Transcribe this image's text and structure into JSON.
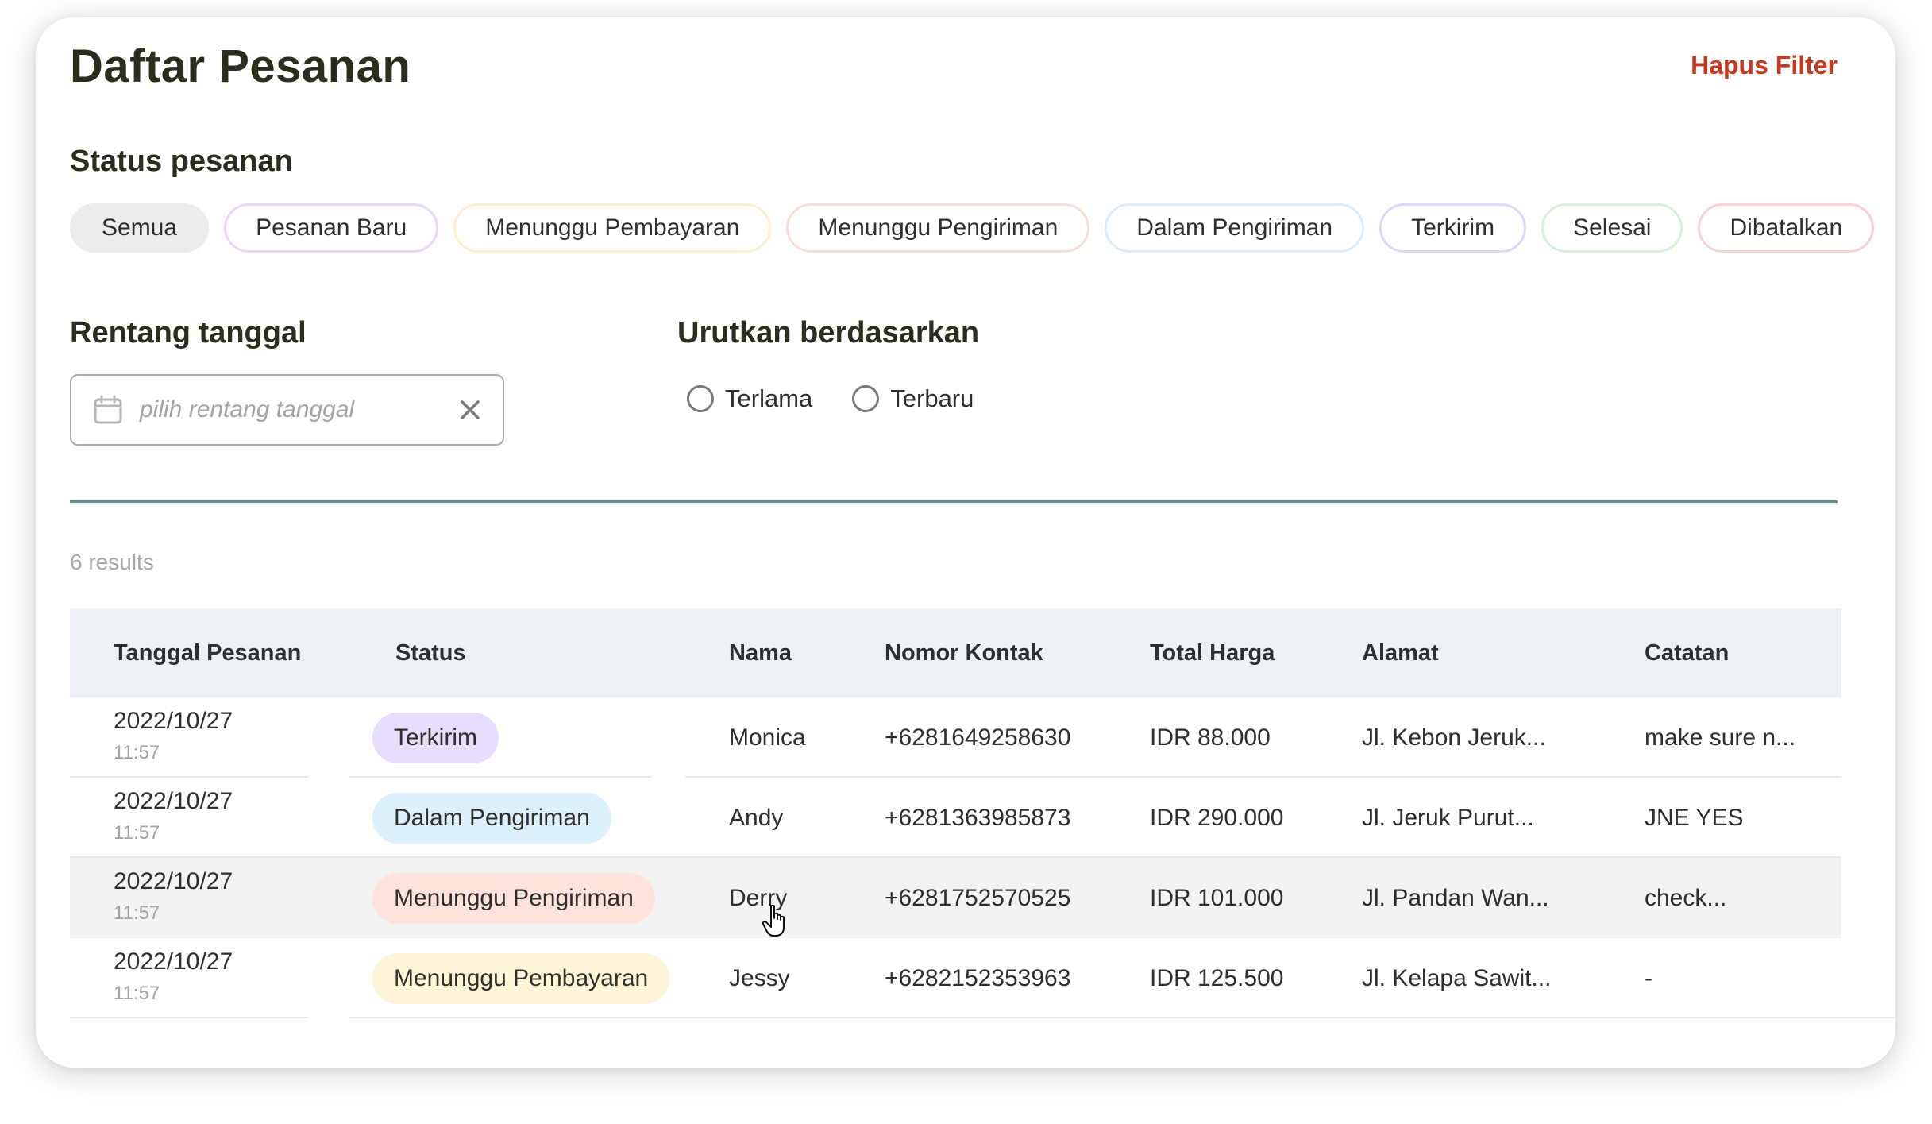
{
  "page": {
    "title": "Daftar Pesanan",
    "clear_filter": "Hapus Filter"
  },
  "status_filter": {
    "label": "Status pesanan",
    "chips": [
      "Semua",
      "Pesanan Baru",
      "Menunggu Pembayaran",
      "Menunggu Pengiriman",
      "Dalam Pengiriman",
      "Terkirim",
      "Selesai",
      "Dibatalkan"
    ],
    "selected": "Semua"
  },
  "date_range": {
    "label": "Rentang tanggal",
    "placeholder": "pilih rentang tanggal"
  },
  "sort": {
    "label": "Urutkan berdasarkan",
    "options": [
      "Terlama",
      "Terbaru"
    ]
  },
  "results_text": "6 results",
  "table": {
    "headers": [
      "Tanggal Pesanan",
      "Status",
      "Nama",
      "Nomor Kontak",
      "Total Harga",
      "Alamat",
      "Catatan"
    ],
    "rows": [
      {
        "date": "2022/10/27",
        "time": "11:57",
        "status": "Terkirim",
        "name": "Monica",
        "phone": "+6281649258630",
        "total": "IDR 88.000",
        "address": "Jl. Kebon Jeruk...",
        "note": "make sure n..."
      },
      {
        "date": "2022/10/27",
        "time": "11:57",
        "status": "Dalam Pengiriman",
        "name": "Andy",
        "phone": "+6281363985873",
        "total": "IDR 290.000",
        "address": "Jl. Jeruk Purut...",
        "note": "JNE YES"
      },
      {
        "date": "2022/10/27",
        "time": "11:57",
        "status": "Menunggu Pengiriman",
        "name": "Derry",
        "phone": "+6281752570525",
        "total": "IDR 101.000",
        "address": "Jl. Pandan Wan...",
        "note": "check..."
      },
      {
        "date": "2022/10/27",
        "time": "11:57",
        "status": "Menunggu Pembayaran",
        "name": "Jessy",
        "phone": "+6282152353963",
        "total": "IDR 125.500",
        "address": "Jl. Kelapa Sawit...",
        "note": "-"
      }
    ]
  },
  "colors": {
    "title": "#2b2d1f",
    "clear_filter": "#c43a1f",
    "divider": "#5e9193",
    "header_bg": "#edf0f5",
    "badge_terkirim": "#e6defa",
    "badge_dalam_pengiriman": "#dcf0fb",
    "badge_menunggu_pengiriman": "#fde3dc",
    "badge_menunggu_pembayaran": "#fdf5d8"
  },
  "icons": [
    "calendar-icon",
    "close-icon",
    "hand-pointer-cursor"
  ]
}
